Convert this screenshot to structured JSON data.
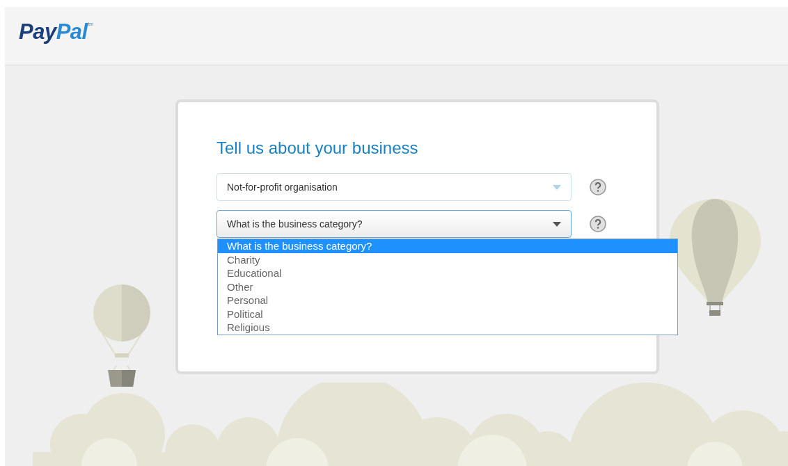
{
  "header": {
    "logo": {
      "first": "Pay",
      "second": "Pal",
      "mark": "tm"
    }
  },
  "form": {
    "title": "Tell us about your business",
    "selects": [
      {
        "value": "Not-for-profit organisation",
        "focused": false
      },
      {
        "value": "What is the business category?",
        "focused": true,
        "options": [
          {
            "label": "What is the business category?",
            "selected": true
          },
          {
            "label": "Charity",
            "selected": false
          },
          {
            "label": "Educational",
            "selected": false
          },
          {
            "label": "Other",
            "selected": false
          },
          {
            "label": "Personal",
            "selected": false
          },
          {
            "label": "Political",
            "selected": false
          },
          {
            "label": "Religious",
            "selected": false
          }
        ]
      }
    ]
  }
}
